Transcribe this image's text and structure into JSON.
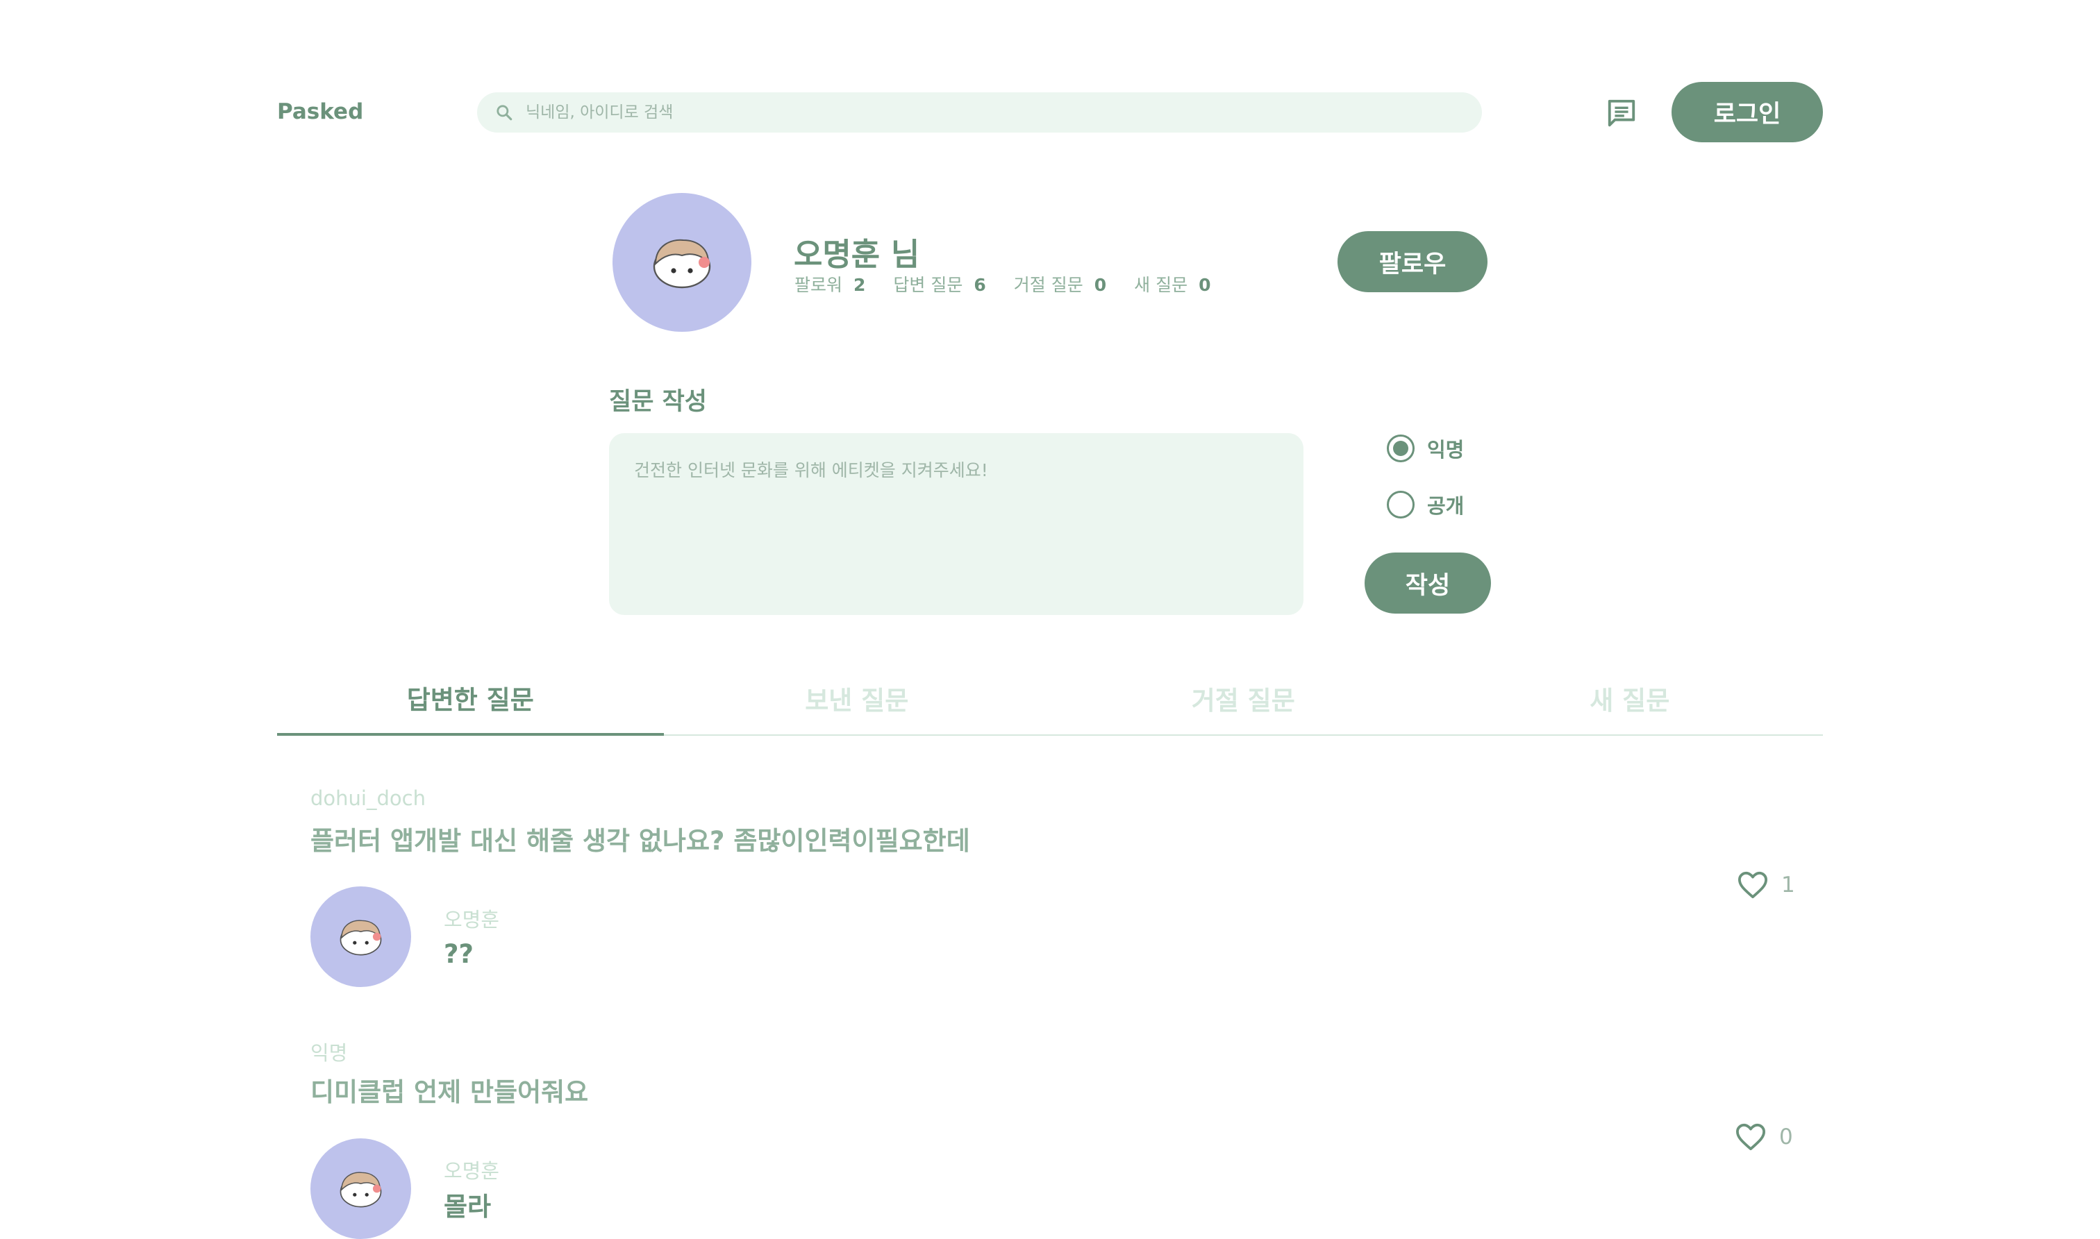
{
  "header": {
    "logo": "Pasked",
    "search_placeholder": "닉네임, 아이디로 검색",
    "login_label": "로그인"
  },
  "icons": {
    "search": "search-icon",
    "messages": "message-icon",
    "like": "heart-icon"
  },
  "profile": {
    "name": "오명훈 님",
    "stats": [
      {
        "label": "팔로워",
        "value": "2"
      },
      {
        "label": "답변 질문",
        "value": "6"
      },
      {
        "label": "거절 질문",
        "value": "0"
      },
      {
        "label": "새 질문",
        "value": "0"
      }
    ],
    "follow_label": "팔로우"
  },
  "compose": {
    "title": "질문 작성",
    "placeholder": "건전한 인터넷 문화를 위해 에티켓을 지켜주세요!",
    "options": [
      {
        "label": "익명",
        "selected": true
      },
      {
        "label": "공개",
        "selected": false
      }
    ],
    "submit_label": "작성"
  },
  "tabs": [
    {
      "label": "답변한 질문",
      "active": true
    },
    {
      "label": "보낸 질문",
      "active": false
    },
    {
      "label": "거절 질문",
      "active": false
    },
    {
      "label": "새 질문",
      "active": false
    }
  ],
  "feed": [
    {
      "asker": "dohui_doch",
      "question": "플러터 앱개발 대신 해줄 생각 없나요? 좀많이인력이필요한데",
      "answerer": "오명훈",
      "answer": "??",
      "likes": "1"
    },
    {
      "asker": "익명",
      "question": "디미클럽 언제 만들어줘요",
      "answerer": "오명훈",
      "answer": "몰라",
      "likes": "0"
    }
  ],
  "colors": {
    "primary": "#6b927b",
    "light_bg": "#ecf6f0",
    "avatar_bg": "#bec2ec",
    "muted": "#c9e0d2"
  }
}
